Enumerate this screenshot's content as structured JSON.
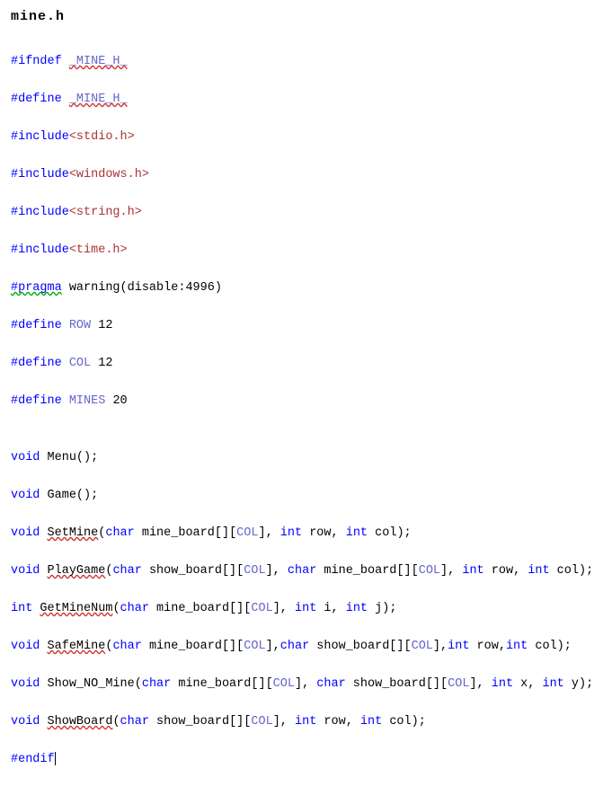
{
  "title": "mine.h",
  "c": {
    "ifndef": "#ifndef",
    "define": "#define",
    "include": "#include",
    "pragma": "#pragma",
    "endif": "#endif",
    "guard": "_MINE_H_",
    "stdio": "<stdio.h>",
    "windows": "<windows.h>",
    "string": "<string.h>",
    "time": "<time.h>",
    "warning_prefix": " warning(disable:4996)",
    "row": "ROW",
    "col": "COL",
    "mines": "MINES",
    "row_v": " 12",
    "col_v": " 12",
    "mines_v": " 20",
    "void": "void",
    "int": "int",
    "char": "char",
    "fn_menu": "Menu",
    "fn_game": "Game",
    "fn_setmine": "SetMine",
    "fn_playgame": "PlayGame",
    "fn_getminenum": "GetMineNum",
    "fn_safemine": "SafeMine",
    "fn_shownomine": "Show_NO_Mine",
    "fn_showboard": "ShowBoard",
    "p_mine_board": " mine_board[][",
    "p_show_board": " show_board[][",
    "p_row": " row",
    "p_col": " col",
    "p_i": " i",
    "p_j": " j",
    "p_x": " x",
    "p_y": " y",
    "close_b": "]",
    "close_b_comma": "], ",
    "close_b_comma_ns": "],",
    "sp": " ",
    "comma": ", ",
    "comma_ns": ",",
    "open_p": "(",
    "close_p_semi": ");",
    "semi": "();",
    "empty": ""
  }
}
